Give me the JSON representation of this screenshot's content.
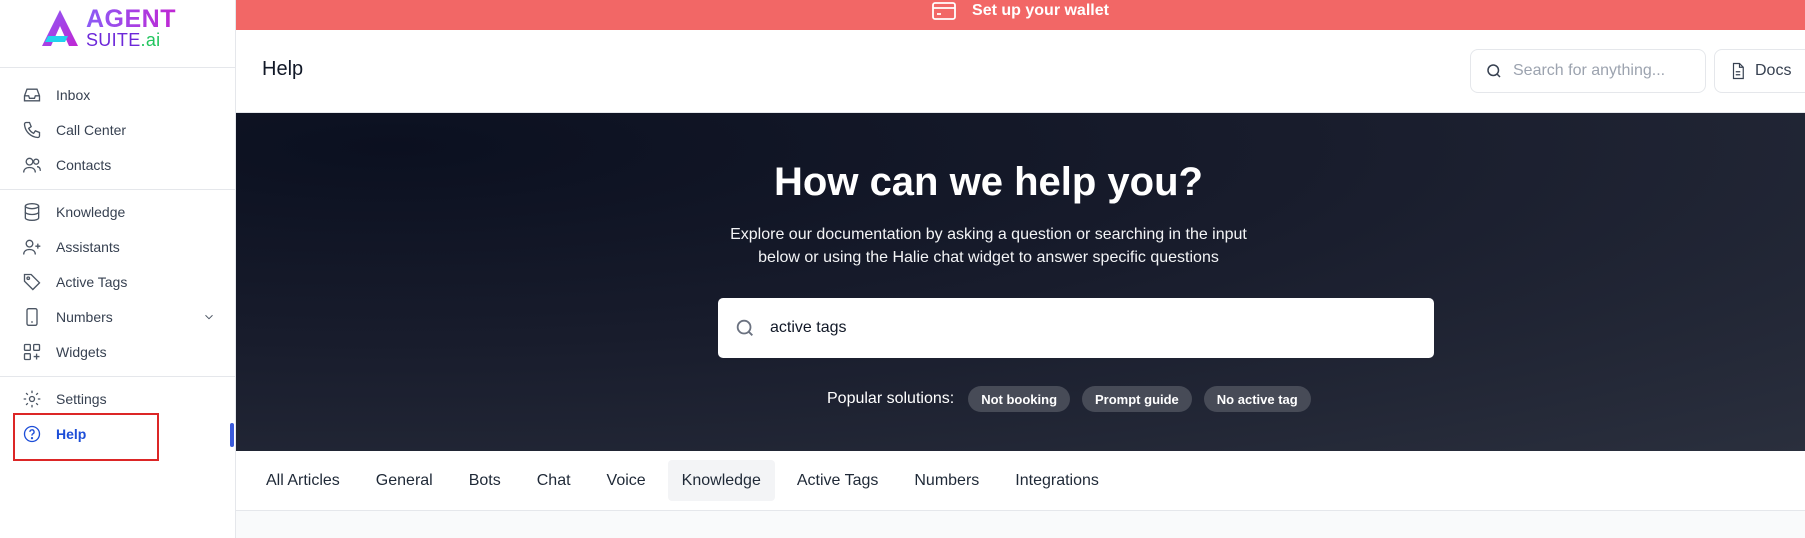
{
  "logo": {
    "line1": "AGENT",
    "line2a": "SUITE",
    "line2b": ".ai"
  },
  "sidebar": {
    "items": [
      {
        "label": "Inbox",
        "icon": "inbox-icon"
      },
      {
        "label": "Call Center",
        "icon": "phone-icon"
      },
      {
        "label": "Contacts",
        "icon": "users-icon"
      },
      {
        "label": "Knowledge",
        "icon": "database-icon"
      },
      {
        "label": "Assistants",
        "icon": "user-plus-icon"
      },
      {
        "label": "Active Tags",
        "icon": "tag-icon"
      },
      {
        "label": "Numbers",
        "icon": "smartphone-icon"
      },
      {
        "label": "Widgets",
        "icon": "widgets-icon"
      },
      {
        "label": "Settings",
        "icon": "gear-icon"
      },
      {
        "label": "Help",
        "icon": "help-circle-icon"
      }
    ],
    "active": "Help"
  },
  "banner": {
    "text": "Set up your wallet",
    "icon": "credit-card-icon"
  },
  "header": {
    "title": "Help",
    "search_placeholder": "Search for anything...",
    "docs_label": "Docs"
  },
  "hero": {
    "title": "How can we help you?",
    "subtitle": "Explore our documentation by asking a question or searching in the input below or using the Halie chat widget to answer specific questions",
    "search_value": "active tags",
    "popular_label": "Popular solutions:",
    "chips": [
      "Not booking",
      "Prompt guide",
      "No active tag"
    ]
  },
  "tabs": {
    "items": [
      "All Articles",
      "General",
      "Bots",
      "Chat",
      "Voice",
      "Knowledge",
      "Active Tags",
      "Numbers",
      "Integrations"
    ],
    "active": "Knowledge"
  },
  "colors": {
    "banner": "#f26766",
    "accent": "#1d4ed8",
    "highlight": "#dc2626"
  }
}
